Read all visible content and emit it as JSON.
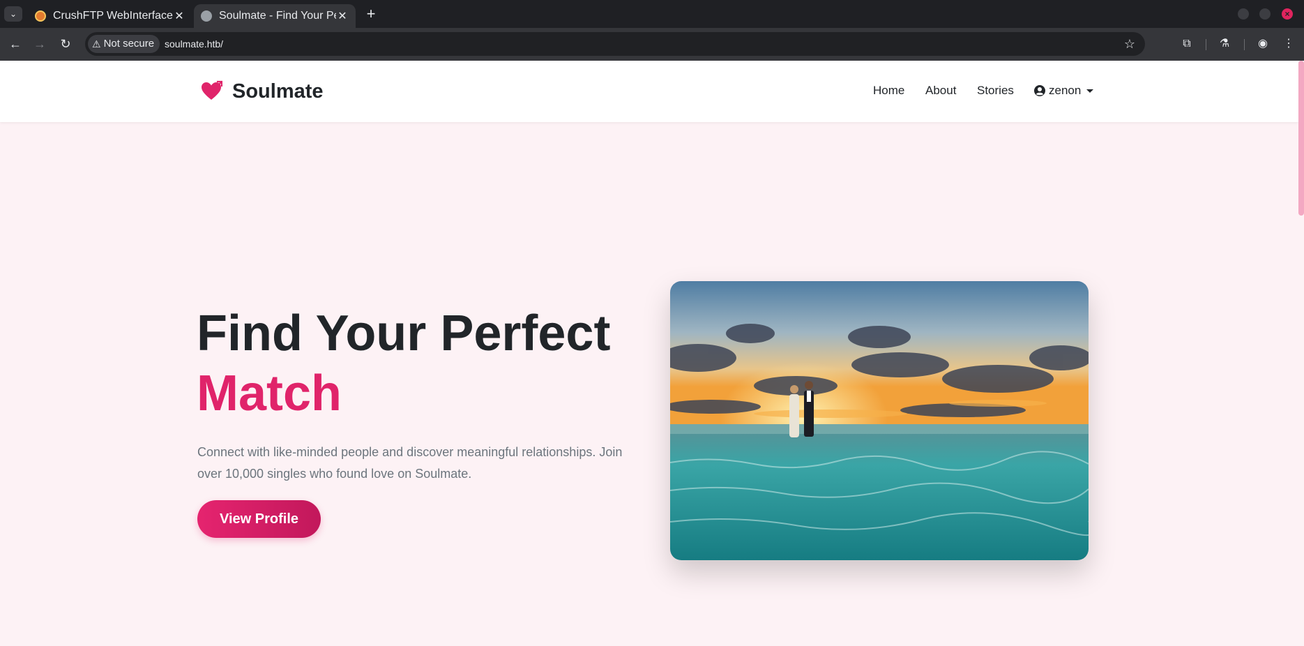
{
  "browser": {
    "tabs": [
      {
        "title": "CrushFTP WebInterface",
        "active": false
      },
      {
        "title": "Soulmate - Find Your Perfect Match",
        "active": true
      }
    ],
    "security_label": "Not secure",
    "url": "soulmate.htb/"
  },
  "site": {
    "brand": "Soulmate",
    "brand_color": "#e0246a",
    "nav": {
      "home": "Home",
      "about": "About",
      "stories": "Stories",
      "user": "zenon"
    }
  },
  "hero": {
    "title_line1": "Find Your Perfect",
    "title_accent": "Match",
    "description": "Connect with like-minded people and discover meaningful relationships. Join over 10,000 singles who found love on Soulmate.",
    "cta_label": "View Profile"
  }
}
